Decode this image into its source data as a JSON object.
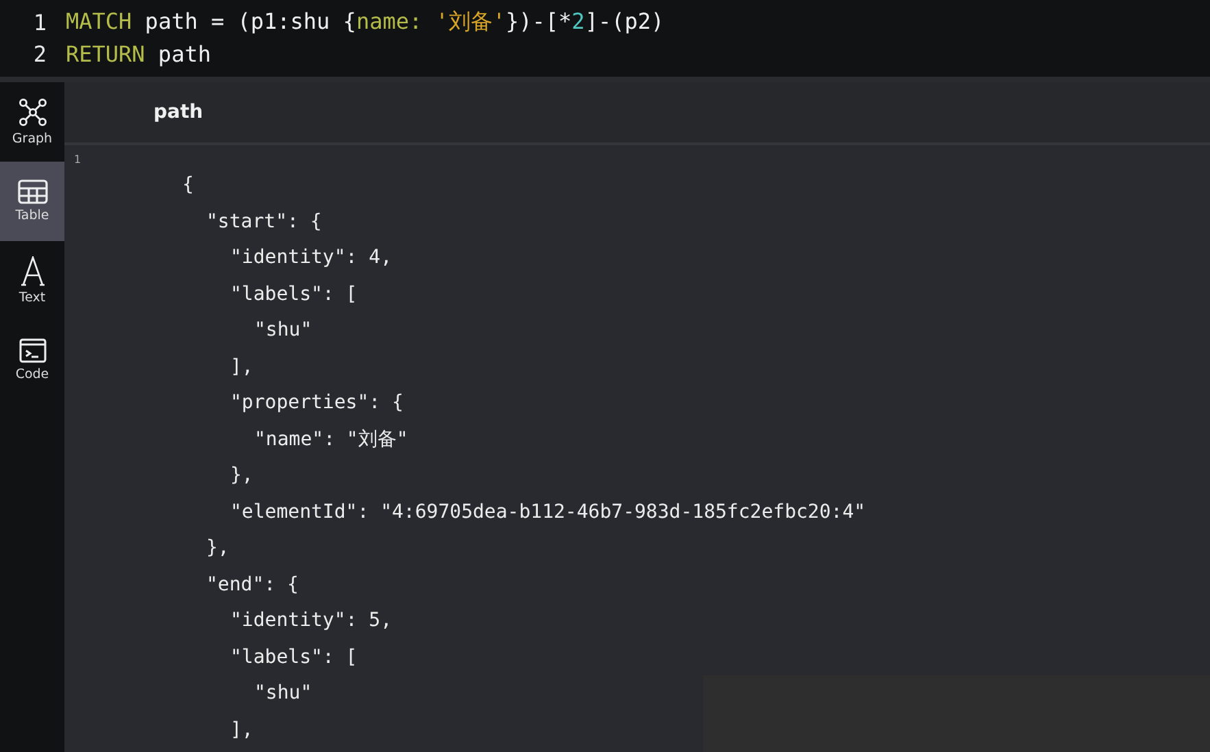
{
  "query_editor": {
    "lines": [
      {
        "number": "1",
        "segments": [
          {
            "kind": "keyword",
            "text": "MATCH"
          },
          {
            "kind": "plain",
            "text": " path = (p1:shu {"
          },
          {
            "kind": "key",
            "text": "name: "
          },
          {
            "kind": "string",
            "text": "'刘备'"
          },
          {
            "kind": "plain",
            "text": "})-[*"
          },
          {
            "kind": "number",
            "text": "2"
          },
          {
            "kind": "plain",
            "text": "]-(p2)"
          }
        ]
      },
      {
        "number": "2",
        "segments": [
          {
            "kind": "keyword",
            "text": "RETURN"
          },
          {
            "kind": "plain",
            "text": " path"
          }
        ]
      }
    ]
  },
  "sidebar": {
    "items": [
      {
        "kind": "graph",
        "label": "Graph",
        "selected": false
      },
      {
        "kind": "table",
        "label": "Table",
        "selected": true
      },
      {
        "kind": "text",
        "label": "Text",
        "selected": false
      },
      {
        "kind": "code",
        "label": "Code",
        "selected": false
      }
    ]
  },
  "result": {
    "column_header": "path",
    "row_number": "1",
    "lines": [
      {
        "text": "{",
        "children": [
          {
            "text": "\"start\": {",
            "children": [
              {
                "text": "\"identity\": 4,"
              },
              {
                "text": "\"labels\": [",
                "children": [
                  {
                    "text": "\"shu\""
                  }
                ]
              },
              {
                "text": "],"
              },
              {
                "text": "\"properties\": {",
                "children": [
                  {
                    "text": "\"name\": \"刘备\""
                  }
                ]
              },
              {
                "text": "},"
              },
              {
                "text": "\"elementId\": \"4:69705dea-b112-46b7-983d-185fc2efbc20:4\""
              }
            ]
          },
          {
            "text": "},"
          },
          {
            "text": "\"end\": {",
            "children": [
              {
                "text": "\"identity\": 5,"
              },
              {
                "text": "\"labels\": [",
                "children": [
                  {
                    "text": "\"shu\""
                  }
                ]
              },
              {
                "text": "],"
              }
            ]
          }
        ]
      }
    ]
  }
}
